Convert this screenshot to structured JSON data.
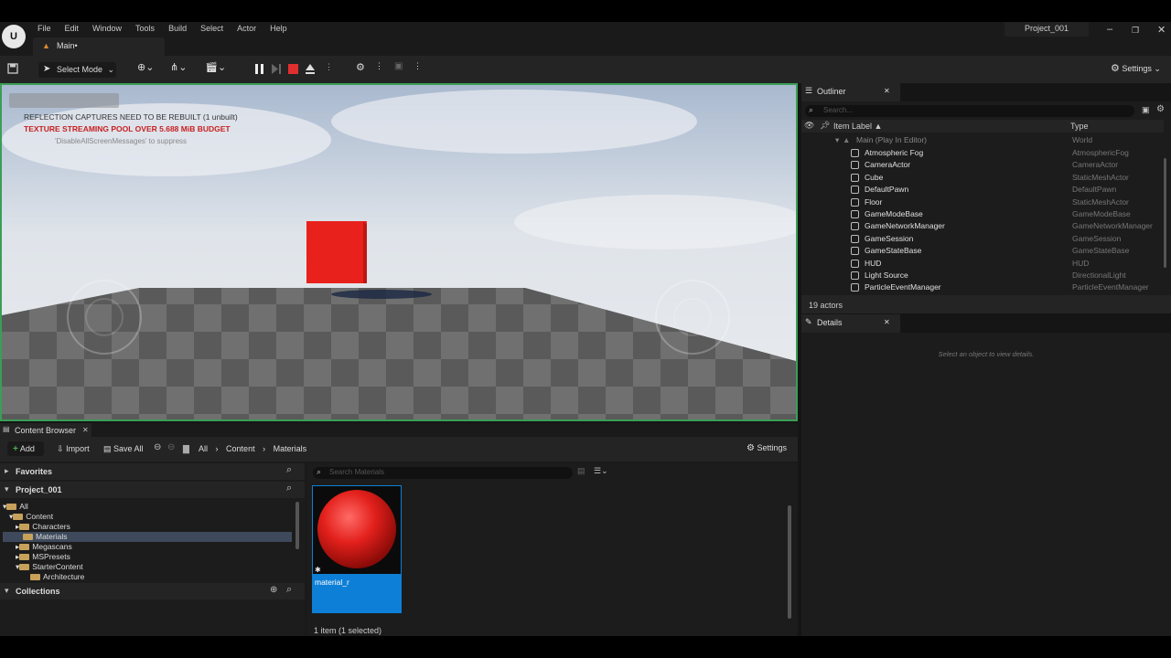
{
  "menubar": {
    "items": [
      "File",
      "Edit",
      "Window",
      "Tools",
      "Build",
      "Select",
      "Actor",
      "Help"
    ],
    "project": "Project_001",
    "tab": "Main•"
  },
  "toolbar": {
    "select_mode": "Select Mode",
    "settings": "Settings"
  },
  "viewport": {
    "msg1": "REFLECTION CAPTURES NEED TO BE REBUILT (1 unbuilt)",
    "msg2": "TEXTURE STREAMING POOL OVER 5.688 MiB BUDGET",
    "msg3": "'DisableAllScreenMessages' to suppress"
  },
  "outliner": {
    "title": "Outliner",
    "search_placeholder": "Search...",
    "col_label": "Item Label ▲",
    "col_type": "Type",
    "root": {
      "label": "Main (Play In Editor)",
      "type": "World"
    },
    "rows": [
      {
        "label": "Atmospheric Fog",
        "type": "AtmosphericFog",
        "icon": "fog-icon"
      },
      {
        "label": "CameraActor",
        "type": "CameraActor",
        "icon": "camera-icon"
      },
      {
        "label": "Cube",
        "type": "StaticMeshActor",
        "icon": "mesh-icon"
      },
      {
        "label": "DefaultPawn",
        "type": "DefaultPawn",
        "icon": "pawn-icon"
      },
      {
        "label": "Floor",
        "type": "StaticMeshActor",
        "icon": "mesh-icon"
      },
      {
        "label": "GameModeBase",
        "type": "GameModeBase",
        "icon": "gamemode-icon"
      },
      {
        "label": "GameNetworkManager",
        "type": "GameNetworkManager",
        "icon": "actor-icon"
      },
      {
        "label": "GameSession",
        "type": "GameSession",
        "icon": "actor-icon"
      },
      {
        "label": "GameStateBase",
        "type": "GameStateBase",
        "icon": "gamestate-icon"
      },
      {
        "label": "HUD",
        "type": "HUD",
        "icon": "hud-icon"
      },
      {
        "label": "Light Source",
        "type": "DirectionalLight",
        "icon": "light-icon"
      },
      {
        "label": "ParticleEventManager",
        "type": "ParticleEventManager",
        "icon": "actor-icon"
      }
    ],
    "count": "19 actors"
  },
  "details": {
    "title": "Details",
    "empty": "Select an object to view details."
  },
  "content_browser": {
    "title": "Content Browser",
    "add": "Add",
    "import": "Import",
    "save_all": "Save All",
    "settings": "Settings",
    "crumbs": [
      "All",
      "Content",
      "Materials"
    ],
    "favorites": "Favorites",
    "project": "Project_001",
    "collections": "Collections",
    "search_placeholder": "Search Materials",
    "tree": {
      "all": "All",
      "content": "Content",
      "characters": "Characters",
      "materials": "Materials",
      "megascans": "Megascans",
      "mspresets": "MSPresets",
      "starter": "StarterContent",
      "architecture": "Architecture"
    },
    "asset": {
      "name": "material_r"
    },
    "status": "1 item (1 selected)"
  },
  "colors": {
    "accent": "#0e7fd6",
    "play_stop": "#e02f2f",
    "viewport_border": "#3a9e56",
    "cube": "#e8211d"
  }
}
